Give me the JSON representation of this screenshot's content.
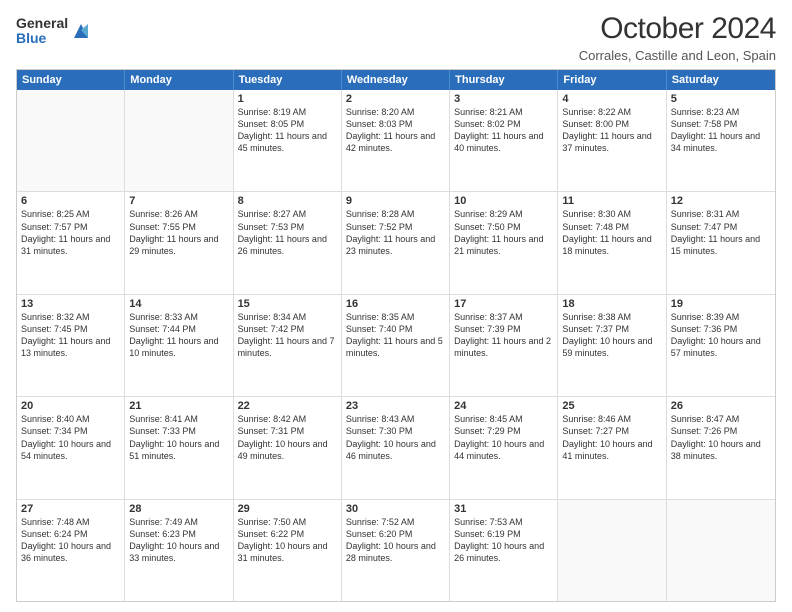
{
  "logo": {
    "general": "General",
    "blue": "Blue"
  },
  "header": {
    "month": "October 2024",
    "location": "Corrales, Castille and Leon, Spain"
  },
  "days": [
    "Sunday",
    "Monday",
    "Tuesday",
    "Wednesday",
    "Thursday",
    "Friday",
    "Saturday"
  ],
  "weeks": [
    [
      {
        "day": "",
        "text": ""
      },
      {
        "day": "",
        "text": ""
      },
      {
        "day": "1",
        "text": "Sunrise: 8:19 AM\nSunset: 8:05 PM\nDaylight: 11 hours and 45 minutes."
      },
      {
        "day": "2",
        "text": "Sunrise: 8:20 AM\nSunset: 8:03 PM\nDaylight: 11 hours and 42 minutes."
      },
      {
        "day": "3",
        "text": "Sunrise: 8:21 AM\nSunset: 8:02 PM\nDaylight: 11 hours and 40 minutes."
      },
      {
        "day": "4",
        "text": "Sunrise: 8:22 AM\nSunset: 8:00 PM\nDaylight: 11 hours and 37 minutes."
      },
      {
        "day": "5",
        "text": "Sunrise: 8:23 AM\nSunset: 7:58 PM\nDaylight: 11 hours and 34 minutes."
      }
    ],
    [
      {
        "day": "6",
        "text": "Sunrise: 8:25 AM\nSunset: 7:57 PM\nDaylight: 11 hours and 31 minutes."
      },
      {
        "day": "7",
        "text": "Sunrise: 8:26 AM\nSunset: 7:55 PM\nDaylight: 11 hours and 29 minutes."
      },
      {
        "day": "8",
        "text": "Sunrise: 8:27 AM\nSunset: 7:53 PM\nDaylight: 11 hours and 26 minutes."
      },
      {
        "day": "9",
        "text": "Sunrise: 8:28 AM\nSunset: 7:52 PM\nDaylight: 11 hours and 23 minutes."
      },
      {
        "day": "10",
        "text": "Sunrise: 8:29 AM\nSunset: 7:50 PM\nDaylight: 11 hours and 21 minutes."
      },
      {
        "day": "11",
        "text": "Sunrise: 8:30 AM\nSunset: 7:48 PM\nDaylight: 11 hours and 18 minutes."
      },
      {
        "day": "12",
        "text": "Sunrise: 8:31 AM\nSunset: 7:47 PM\nDaylight: 11 hours and 15 minutes."
      }
    ],
    [
      {
        "day": "13",
        "text": "Sunrise: 8:32 AM\nSunset: 7:45 PM\nDaylight: 11 hours and 13 minutes."
      },
      {
        "day": "14",
        "text": "Sunrise: 8:33 AM\nSunset: 7:44 PM\nDaylight: 11 hours and 10 minutes."
      },
      {
        "day": "15",
        "text": "Sunrise: 8:34 AM\nSunset: 7:42 PM\nDaylight: 11 hours and 7 minutes."
      },
      {
        "day": "16",
        "text": "Sunrise: 8:35 AM\nSunset: 7:40 PM\nDaylight: 11 hours and 5 minutes."
      },
      {
        "day": "17",
        "text": "Sunrise: 8:37 AM\nSunset: 7:39 PM\nDaylight: 11 hours and 2 minutes."
      },
      {
        "day": "18",
        "text": "Sunrise: 8:38 AM\nSunset: 7:37 PM\nDaylight: 10 hours and 59 minutes."
      },
      {
        "day": "19",
        "text": "Sunrise: 8:39 AM\nSunset: 7:36 PM\nDaylight: 10 hours and 57 minutes."
      }
    ],
    [
      {
        "day": "20",
        "text": "Sunrise: 8:40 AM\nSunset: 7:34 PM\nDaylight: 10 hours and 54 minutes."
      },
      {
        "day": "21",
        "text": "Sunrise: 8:41 AM\nSunset: 7:33 PM\nDaylight: 10 hours and 51 minutes."
      },
      {
        "day": "22",
        "text": "Sunrise: 8:42 AM\nSunset: 7:31 PM\nDaylight: 10 hours and 49 minutes."
      },
      {
        "day": "23",
        "text": "Sunrise: 8:43 AM\nSunset: 7:30 PM\nDaylight: 10 hours and 46 minutes."
      },
      {
        "day": "24",
        "text": "Sunrise: 8:45 AM\nSunset: 7:29 PM\nDaylight: 10 hours and 44 minutes."
      },
      {
        "day": "25",
        "text": "Sunrise: 8:46 AM\nSunset: 7:27 PM\nDaylight: 10 hours and 41 minutes."
      },
      {
        "day": "26",
        "text": "Sunrise: 8:47 AM\nSunset: 7:26 PM\nDaylight: 10 hours and 38 minutes."
      }
    ],
    [
      {
        "day": "27",
        "text": "Sunrise: 7:48 AM\nSunset: 6:24 PM\nDaylight: 10 hours and 36 minutes."
      },
      {
        "day": "28",
        "text": "Sunrise: 7:49 AM\nSunset: 6:23 PM\nDaylight: 10 hours and 33 minutes."
      },
      {
        "day": "29",
        "text": "Sunrise: 7:50 AM\nSunset: 6:22 PM\nDaylight: 10 hours and 31 minutes."
      },
      {
        "day": "30",
        "text": "Sunrise: 7:52 AM\nSunset: 6:20 PM\nDaylight: 10 hours and 28 minutes."
      },
      {
        "day": "31",
        "text": "Sunrise: 7:53 AM\nSunset: 6:19 PM\nDaylight: 10 hours and 26 minutes."
      },
      {
        "day": "",
        "text": ""
      },
      {
        "day": "",
        "text": ""
      }
    ]
  ]
}
